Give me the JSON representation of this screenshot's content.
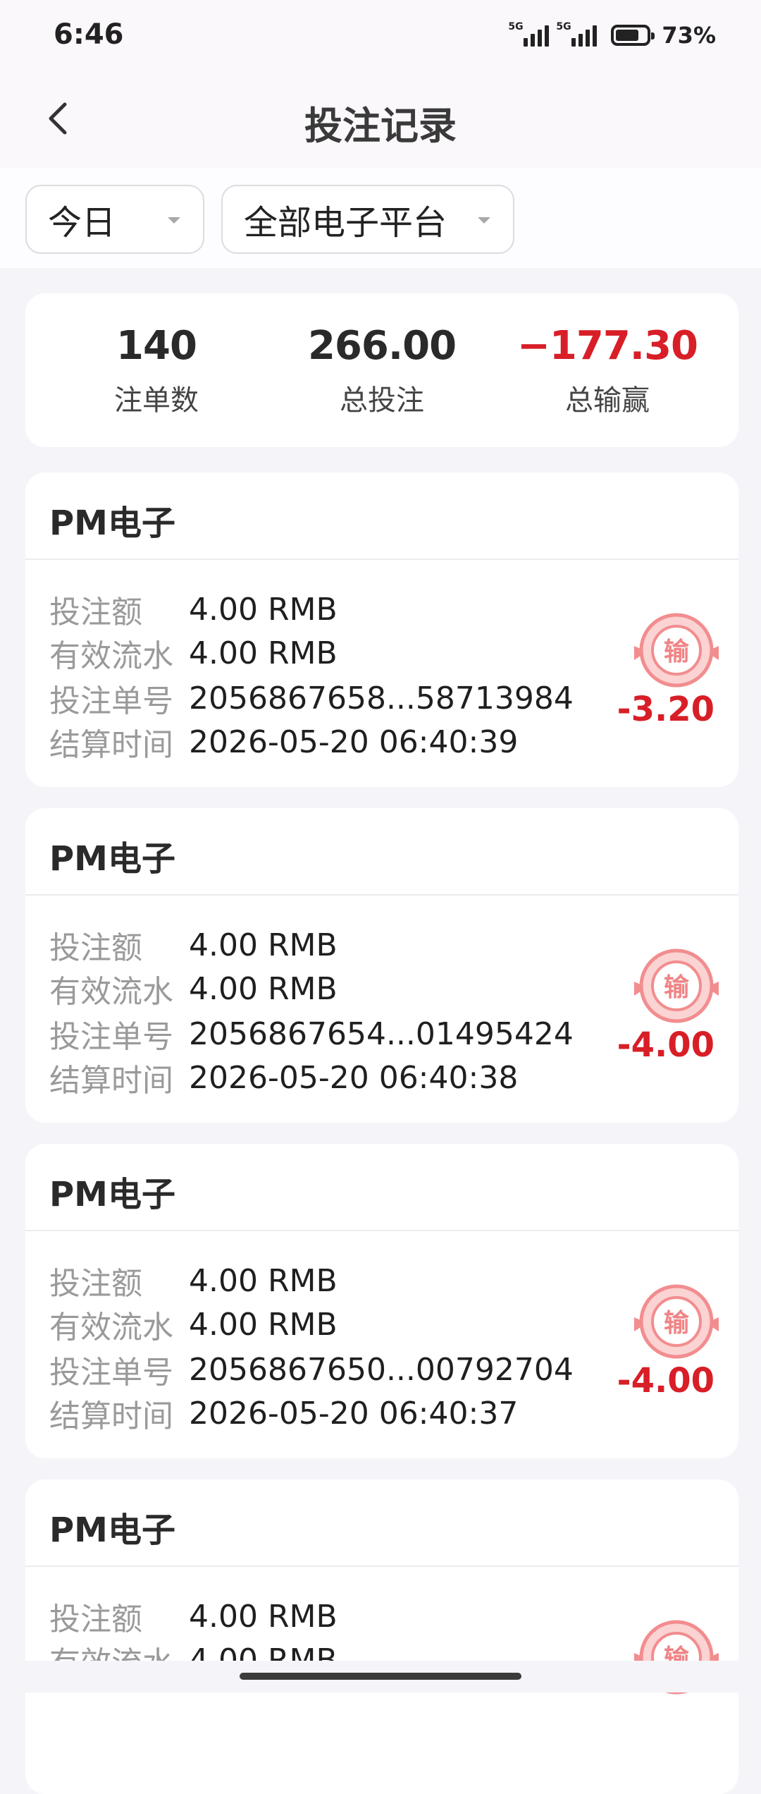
{
  "status": {
    "time": "6:46",
    "sim1": "5G",
    "sim2": "5G",
    "battery": "73%"
  },
  "header": {
    "title": "投注记录"
  },
  "filters": {
    "date": "今日",
    "platform": "全部电子平台"
  },
  "summary": {
    "count_value": "140",
    "count_label": "注单数",
    "bet_value": "266.00",
    "bet_label": "总投注",
    "win_value": "−177.30",
    "win_label": "总输赢"
  },
  "labels": {
    "bet": "投注额",
    "valid": "有效流水",
    "order": "投注单号",
    "time": "结算时间",
    "lose_badge": "输"
  },
  "colors": {
    "accent_red": "#d81e27",
    "badge_pink": "#f28d8f"
  },
  "records": [
    {
      "title": "PM电子",
      "bet": "4.00 RMB",
      "valid": "4.00 RMB",
      "order": "2056867658...58713984",
      "time": "2026-05-20 06:40:39",
      "amount": "-3.20"
    },
    {
      "title": "PM电子",
      "bet": "4.00 RMB",
      "valid": "4.00 RMB",
      "order": "2056867654...01495424",
      "time": "2026-05-20 06:40:38",
      "amount": "-4.00"
    },
    {
      "title": "PM电子",
      "bet": "4.00 RMB",
      "valid": "4.00 RMB",
      "order": "2056867650...00792704",
      "time": "2026-05-20 06:40:37",
      "amount": "-4.00"
    },
    {
      "title": "PM电子",
      "bet": "4.00 RMB",
      "valid": "4.00 RMB",
      "order": "",
      "time": "",
      "amount": ""
    }
  ]
}
